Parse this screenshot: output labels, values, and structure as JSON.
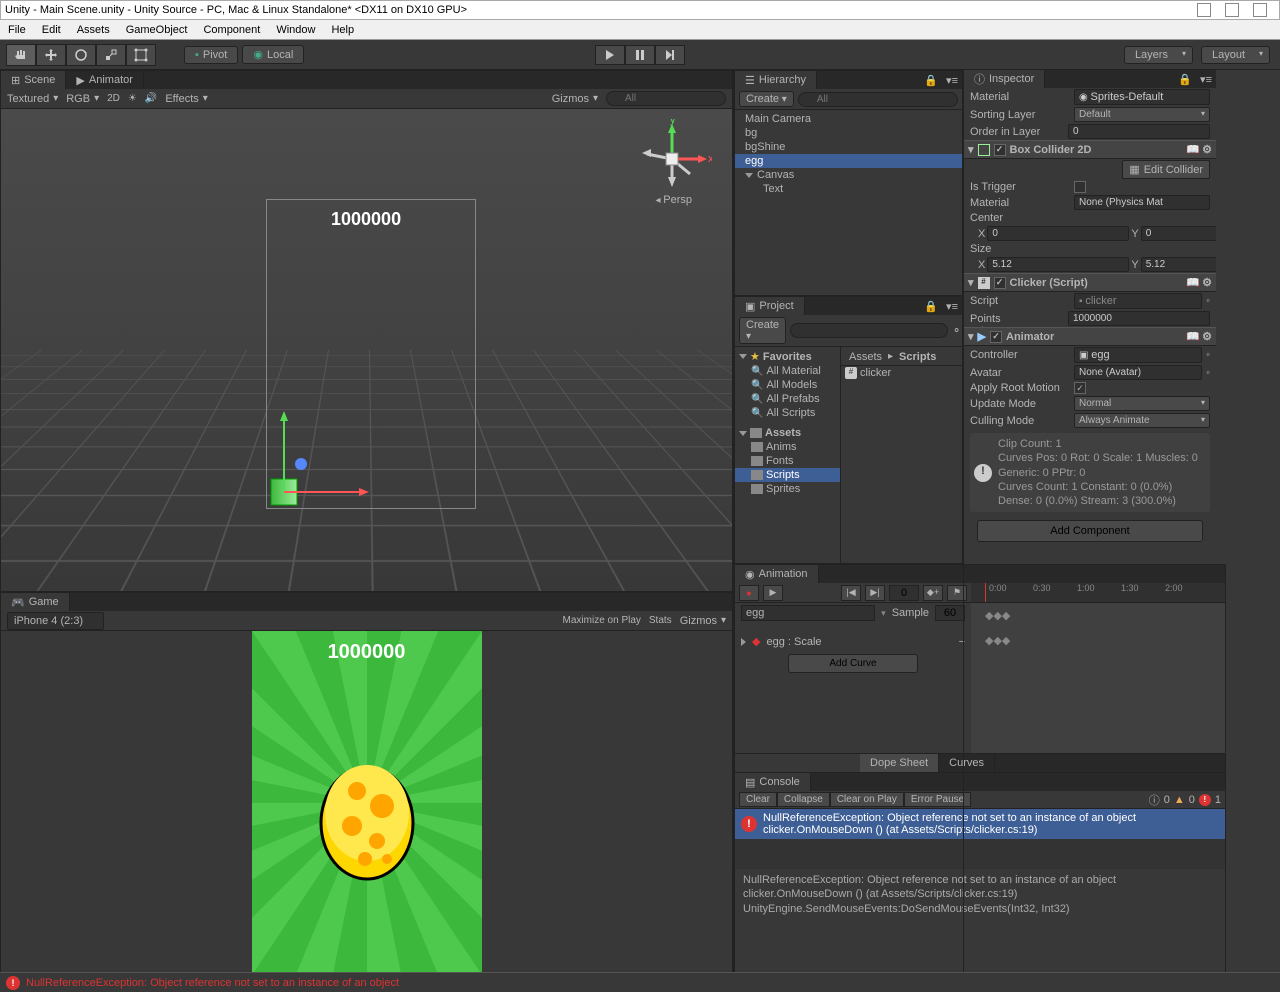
{
  "title": "Unity - Main Scene.unity - Unity Source - PC, Mac & Linux Standalone* <DX11 on DX10 GPU>",
  "menu": [
    "File",
    "Edit",
    "Assets",
    "GameObject",
    "Component",
    "Window",
    "Help"
  ],
  "toolbar": {
    "pivot": "Pivot",
    "local": "Local",
    "layers": "Layers",
    "layout": "Layout"
  },
  "scene": {
    "tab_scene": "Scene",
    "tab_animator": "Animator",
    "textured": "Textured",
    "rgb": "RGB",
    "two_d": "2D",
    "effects": "Effects",
    "gizmos": "Gizmos",
    "search_placeholder": "All",
    "persp": "Persp",
    "score_text": "1000000",
    "axis_x": "x",
    "axis_y": "y"
  },
  "game": {
    "tab": "Game",
    "device": "iPhone 4 (2:3)",
    "maximize": "Maximize on Play",
    "stats": "Stats",
    "gizmos": "Gizmos",
    "score": "1000000"
  },
  "hierarchy": {
    "tab": "Hierarchy",
    "create": "Create",
    "search_placeholder": "All",
    "items": [
      "Main Camera",
      "bg",
      "bgShine",
      "egg",
      "Canvas",
      "Text"
    ]
  },
  "project": {
    "tab": "Project",
    "create": "Create",
    "favorites": "Favorites",
    "fav_items": [
      "All Material",
      "All Models",
      "All Prefabs",
      "All Scripts"
    ],
    "assets": "Assets",
    "folders": [
      "Anims",
      "Fonts",
      "Scripts",
      "Sprites"
    ],
    "breadcrumb_assets": "Assets",
    "breadcrumb_scripts": "Scripts",
    "files": [
      "clicker"
    ]
  },
  "animation": {
    "tab": "Animation",
    "clip": "egg",
    "sample_label": "Sample",
    "sample": "60",
    "frame": "0",
    "track": "egg : Scale",
    "add_curve": "Add Curve",
    "dope": "Dope Sheet",
    "curves": "Curves",
    "ticks": [
      "0:00",
      "0:30",
      "1:00",
      "1:30",
      "2:00"
    ]
  },
  "console": {
    "tab": "Console",
    "clear": "Clear",
    "collapse": "Collapse",
    "clear_on_play": "Clear on Play",
    "error_pause": "Error Pause",
    "count_info": "0",
    "count_warn": "0",
    "count_err": "1",
    "error_line1": "NullReferenceException: Object reference not set to an instance of an object",
    "error_line2": "clicker.OnMouseDown () (at Assets/Scripts/clicker.cs:19)",
    "detail_line1": "NullReferenceException: Object reference not set to an instance of an object",
    "detail_line2": "clicker.OnMouseDown () (at Assets/Scripts/clicker.cs:19)",
    "detail_line3": "UnityEngine.SendMouseEvents:DoSendMouseEvents(Int32, Int32)"
  },
  "inspector": {
    "tab": "Inspector",
    "material_label": "Material",
    "material_value": "Sprites-Default",
    "sorting_layer": "Sorting Layer",
    "sorting_layer_value": "Default",
    "order_label": "Order in Layer",
    "order_value": "0",
    "box_collider": "Box Collider 2D",
    "edit_collider": "Edit Collider",
    "is_trigger": "Is Trigger",
    "collider_material": "Material",
    "collider_material_value": "None (Physics Mat",
    "center": "Center",
    "center_x": "0",
    "center_y": "0",
    "size": "Size",
    "size_x": "5.12",
    "size_y": "5.12",
    "clicker": "Clicker (Script)",
    "script_label": "Script",
    "script_value": "clicker",
    "points_label": "Points",
    "points_value": "1000000",
    "animator": "Animator",
    "controller": "Controller",
    "controller_value": "egg",
    "avatar": "Avatar",
    "avatar_value": "None (Avatar)",
    "apply_root": "Apply Root Motion",
    "update_mode": "Update Mode",
    "update_mode_value": "Normal",
    "culling_mode": "Culling Mode",
    "culling_mode_value": "Always Animate",
    "info1": "Clip Count: 1",
    "info2": "Curves Pos: 0 Rot: 0 Scale: 1 Muscles: 0 Generic: 0 PPtr: 0",
    "info3": "Curves Count: 1 Constant: 0 (0.0%) Dense: 0 (0.0%) Stream: 3 (300.0%)",
    "add_component": "Add Component"
  },
  "statusbar": {
    "error": "NullReferenceException: Object reference not set to an instance of an object"
  }
}
